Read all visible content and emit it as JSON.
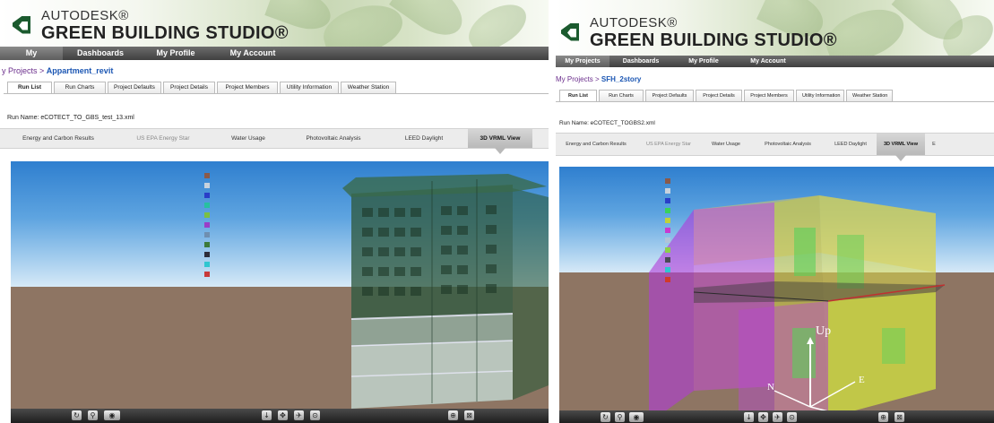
{
  "app": {
    "brand_line1": "AUTODESK®",
    "brand_line2": "GREEN BUILDING STUDIO®",
    "nav": [
      "My Projects",
      "Dashboards",
      "My Profile",
      "My Account"
    ],
    "project_tabs": [
      "Run List",
      "Run Charts",
      "Project Defaults",
      "Project Details",
      "Project Members",
      "Utility Information",
      "Weather Station"
    ],
    "results_tabs": [
      "Energy and Carbon Results",
      "US EPA Energy Star",
      "Water Usage",
      "Photovoltaic Analysis",
      "LEED Daylight",
      "3D VRML View"
    ],
    "colors": {
      "nav_bg": "#4a4a4a",
      "crumb": "#6b2e8c",
      "project_link": "#1b56b3",
      "sky": "#5ea4e0",
      "ground": "#8e7563"
    }
  },
  "left": {
    "breadcrumb_prefix": "y Projects >",
    "project_name": "Appartment_revit",
    "run_name": "Run Name: eCOTECT_TO_GBS_test_13.xml",
    "legend_colors": [
      "#8a5a4a",
      "#c8d2dd",
      "#2a3ec8",
      "#27c0a0",
      "#7ac043",
      "#9a3dc8",
      "#6f8fb0",
      "#3c7a3a",
      "#2d2d3a",
      "#2fc6d0",
      "#c83a3a"
    ],
    "toolbar_icons": [
      "orbit-icon",
      "walk-icon",
      "eye-icon",
      "down-arrow-icon",
      "pan-icon",
      "fly-icon",
      "target-icon",
      "zoom-icon",
      "fit-icon"
    ]
  },
  "right": {
    "breadcrumb_prefix": "My Projects >",
    "project_name": "SFH_2story",
    "run_name": "Run Name: eCOTECT_TOGBS2.xml",
    "overflow_tab": "E",
    "legend_colors": [
      "#8a5a4a",
      "#c8d2dd",
      "#2a3ec8",
      "#3ad15a",
      "#c0d23a",
      "#c83ad0",
      "#b0c4d8",
      "#8ad04a",
      "#4a4a55",
      "#2fc6d0",
      "#d03a2a"
    ],
    "axis": {
      "up": "Up",
      "east": "E",
      "north": "N"
    },
    "toolbar_icons": [
      "orbit-icon",
      "walk-icon",
      "eye-icon",
      "down-arrow-icon",
      "pan-icon",
      "fly-icon",
      "target-icon",
      "zoom-icon",
      "fit-icon"
    ]
  }
}
